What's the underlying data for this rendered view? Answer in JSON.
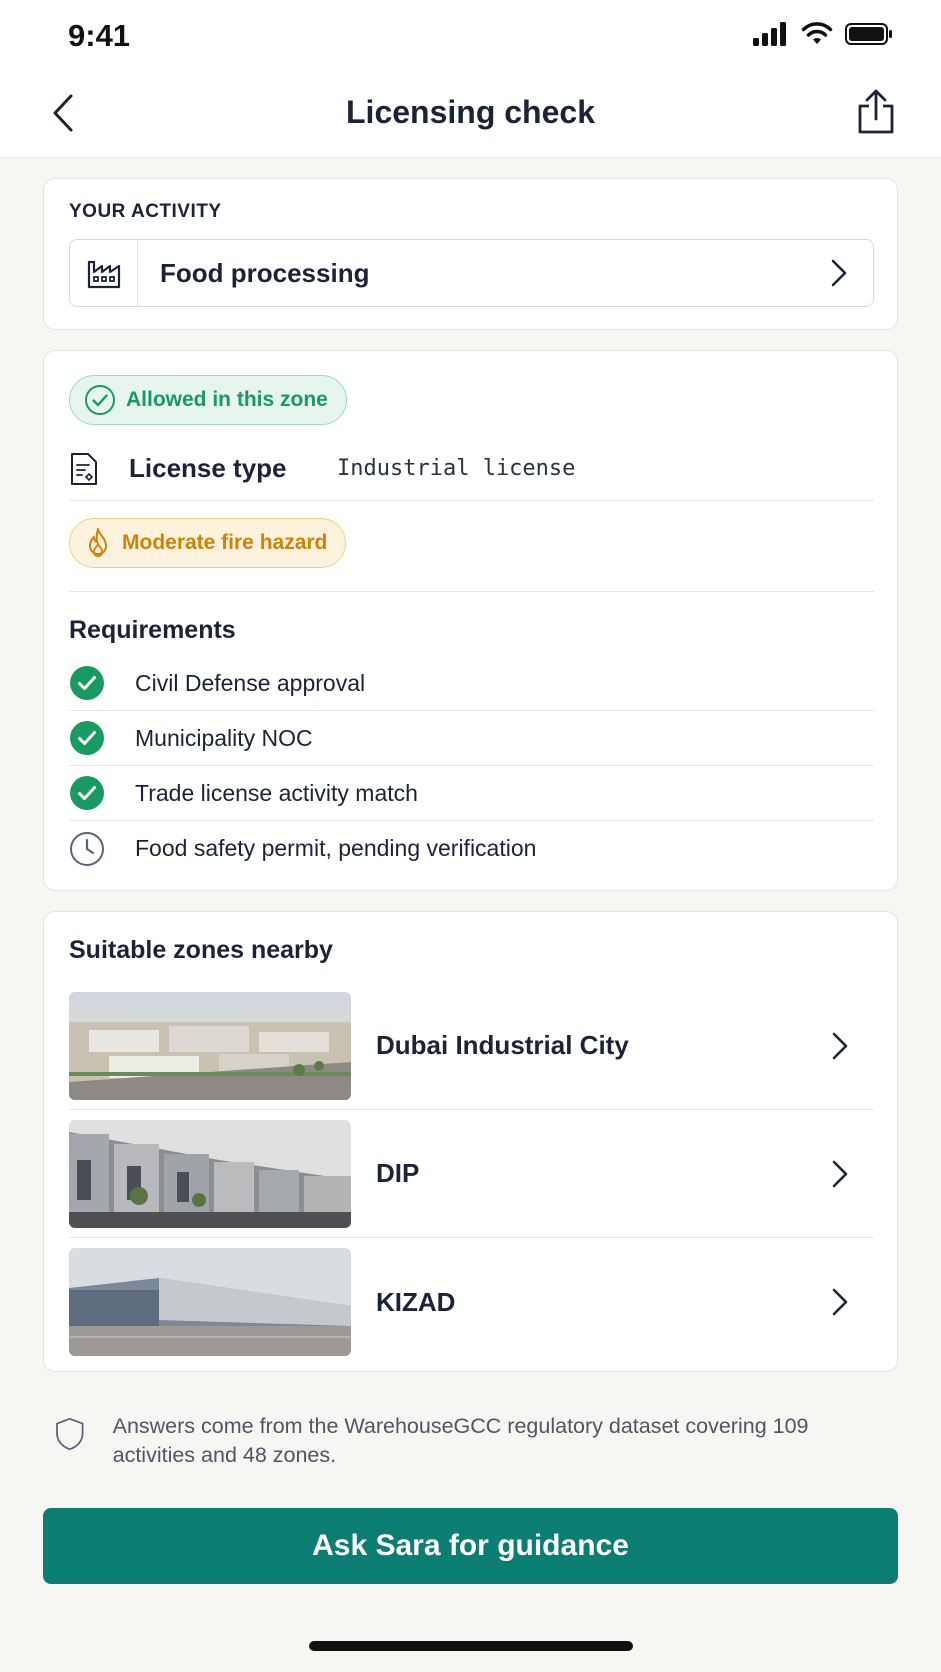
{
  "status_bar": {
    "time": "9:41"
  },
  "nav": {
    "title": "Licensing check",
    "back_icon": "chevron-left-icon",
    "share_icon": "share-icon"
  },
  "activity": {
    "label": "YOUR ACTIVITY",
    "value": "Food processing",
    "icon": "factory-icon"
  },
  "license": {
    "zone_status": "Allowed in this zone",
    "type_label": "License type",
    "type_value": "Industrial license",
    "hazard": "Moderate fire hazard",
    "requirements_title": "Requirements",
    "requirements": [
      {
        "text": "Civil Defense approval",
        "status": "done"
      },
      {
        "text": "Municipality NOC",
        "status": "done"
      },
      {
        "text": "Trade license activity match",
        "status": "done"
      },
      {
        "text": "Food safety permit, pending verification",
        "status": "pending"
      }
    ]
  },
  "zones": {
    "title": "Suitable zones nearby",
    "items": [
      {
        "name": "Dubai Industrial City"
      },
      {
        "name": "DIP"
      },
      {
        "name": "KIZAD"
      }
    ]
  },
  "footnote": {
    "text": "Answers come from the WarehouseGCC regulatory dataset covering 109 activities and 48 zones."
  },
  "cta": {
    "label": "Ask Sara for guidance"
  },
  "colors": {
    "accent": "#0b7d73",
    "success": "#1a9a63",
    "warning": "#d0820a"
  }
}
